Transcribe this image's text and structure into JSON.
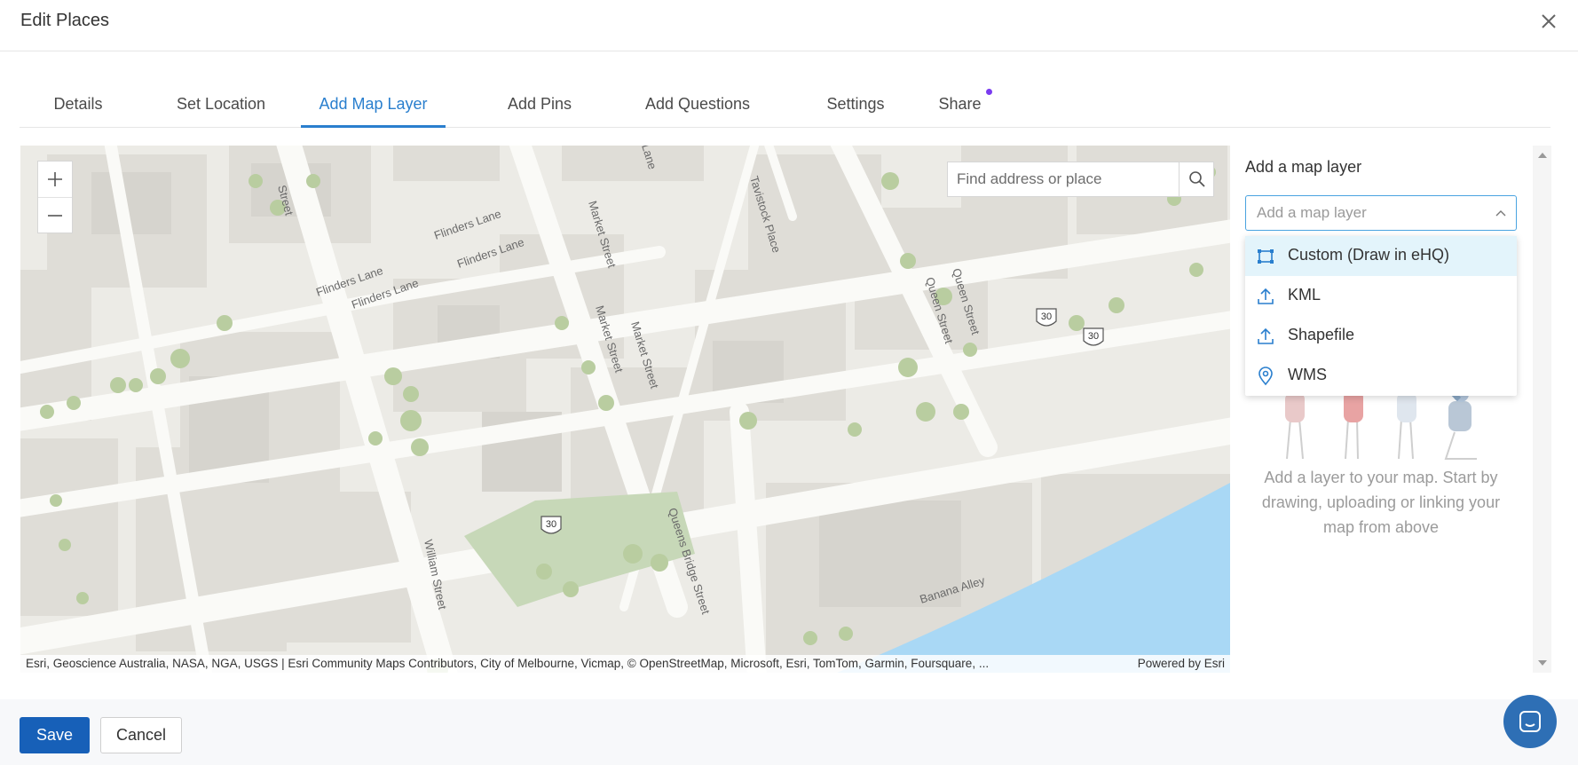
{
  "header": {
    "title": "Edit Places"
  },
  "tabs": [
    {
      "label": "Details"
    },
    {
      "label": "Set Location"
    },
    {
      "label": "Add Map Layer"
    },
    {
      "label": "Add Pins"
    },
    {
      "label": "Add Questions"
    },
    {
      "label": "Settings"
    },
    {
      "label": "Share"
    }
  ],
  "active_tab": "Add Map Layer",
  "map": {
    "search_placeholder": "Find address or place",
    "attribution": "Esri, Geoscience Australia, NASA, NGA, USGS | Esri Community Maps Contributors, City of Melbourne, Vicmap, © OpenStreetMap, Microsoft, Esri, TomTom, Garmin, Foursquare, ...",
    "powered_by": "Powered by Esri",
    "streets": {
      "s1": "Street",
      "flinders1": "Flinders Lane",
      "flinders2": "Flinders Lane",
      "flinders3": "Flinders Lane",
      "flinders4": "Flinders Lane",
      "market1": "Market Street",
      "market2": "Market Street",
      "market3": "Market Street",
      "tavistock": "Tavistock Place",
      "queen1": "Queen Street",
      "queen2": "Queen Street",
      "lane": "Lane",
      "william": "William Street",
      "queensbridge": "Queens Bridge Street",
      "banana": "Banana Alley",
      "route": "30"
    }
  },
  "sidebar": {
    "label": "Add a map layer",
    "select_placeholder": "Add a map layer",
    "options": [
      {
        "label": "Custom (Draw in eHQ)",
        "icon": "draw-polygon-icon"
      },
      {
        "label": "KML",
        "icon": "upload-icon"
      },
      {
        "label": "Shapefile",
        "icon": "upload-icon"
      },
      {
        "label": "WMS",
        "icon": "location-pin-icon"
      }
    ],
    "empty_text": "Add a layer to your map. Start by drawing, uploading or linking your map from above"
  },
  "footer": {
    "save_label": "Save",
    "cancel_label": "Cancel"
  },
  "colors": {
    "accent": "#2a7fce",
    "primary_button": "#1760b8",
    "highlight": "#e3f4fb",
    "notification_dot": "#7a3cf0"
  }
}
